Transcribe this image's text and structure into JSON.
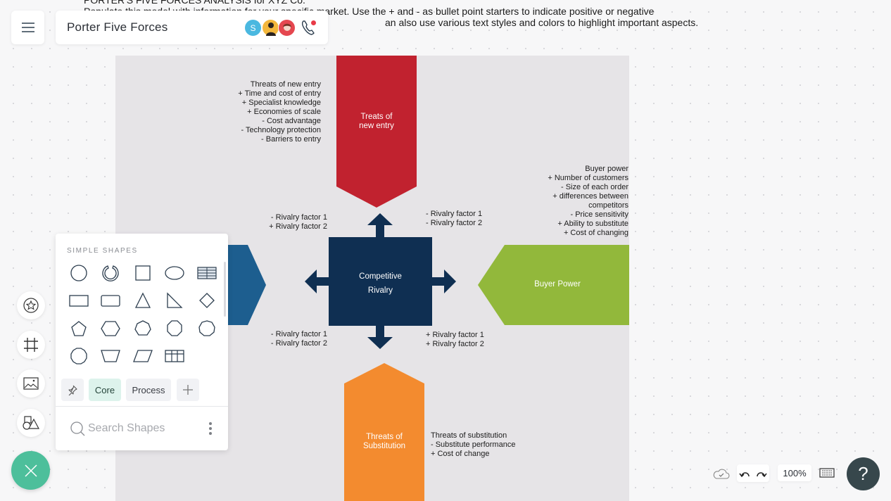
{
  "description": {
    "line1": "PORTER'S FIVE FORCES ANALYSIS for XYZ Co.",
    "line2": "Populate this model with information for your specific market. Use the + and - as bullet point starters to indicate positive or negative",
    "line3": "an also use various text styles and colors to highlight important aspects."
  },
  "header": {
    "title": "Porter Five Forces",
    "avatars": [
      {
        "initial": "S",
        "color": "#4ab8e0"
      },
      {
        "initial": "",
        "color": "#f3b73c"
      },
      {
        "initial": "",
        "color": "#e5474f"
      }
    ],
    "call_status_color": "#e83a47"
  },
  "diagram": {
    "colors": {
      "new_entry": "#c1222f",
      "supplier": "#1d5e8f",
      "rivalry": "#0f2f52",
      "buyer": "#92b83b",
      "substitution": "#f38b2f",
      "board": "#e6e4e7"
    },
    "new_entry": {
      "label_lines": [
        "Treats of",
        "new entry"
      ],
      "notes": [
        "Threats of new entry",
        "+ Time and cost of entry",
        "+ Specialist knowledge",
        "+ Economies of scale",
        "- Cost advantage",
        "- Technology protection",
        "- Barriers to entry"
      ]
    },
    "rivalry": {
      "label_lines": [
        "Competitive",
        "Rivalry"
      ],
      "top_left": [
        "- Rivalry factor 1",
        "+ Rivalry factor 2"
      ],
      "top_right": [
        "- Rivalry factor 1",
        "- Rivalry factor 2"
      ],
      "bottom_left": [
        "- Rivalry factor 1",
        "- Rivalry factor 2"
      ],
      "bottom_right": [
        "+ Rivalry factor 1",
        "+ Rivalry factor 2"
      ]
    },
    "buyer": {
      "label": "Buyer Power",
      "notes": [
        "Buyer power",
        "+ Number of customers",
        "- Size of each order",
        "+ differences between",
        "competitors",
        "- Price sensitivity",
        "+ Ability to substitute",
        "+ Cost of changing"
      ]
    },
    "substitution": {
      "label_lines": [
        "Threats of",
        "Substitution"
      ],
      "notes": [
        "Threats of substitution",
        "- Substitute performance",
        "+ Cost of change"
      ]
    }
  },
  "shapes_panel": {
    "heading": "SIMPLE SHAPES",
    "shapes": [
      "circle",
      "arc",
      "square",
      "ellipse",
      "table",
      "rectangle",
      "rounded-rectangle",
      "triangle",
      "right-triangle",
      "diamond",
      "pentagon",
      "hexagon",
      "heptagon",
      "octagon",
      "nonagon",
      "decagon",
      "trapezoid",
      "parallelogram",
      "grid"
    ],
    "tabs": [
      {
        "label": "Core",
        "active": true
      },
      {
        "label": "Process",
        "active": false
      }
    ],
    "search_placeholder": "Search Shapes"
  },
  "tools": [
    "sticker-tool",
    "frame-tool",
    "image-tool",
    "shapes-tool"
  ],
  "footer": {
    "zoom": "100%",
    "help": "?"
  }
}
